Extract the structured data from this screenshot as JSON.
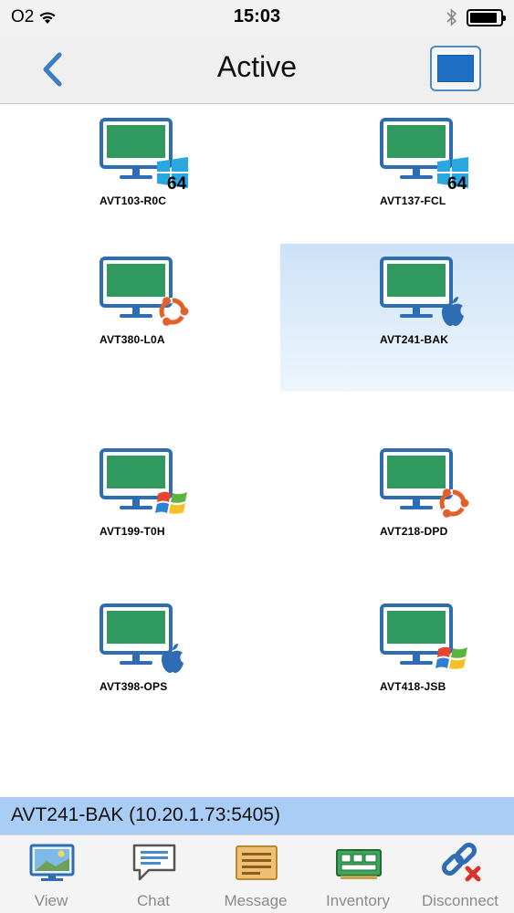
{
  "status_bar": {
    "carrier": "O2",
    "time": "15:03",
    "battery_level": 0.9
  },
  "nav": {
    "title": "Active",
    "back_icon": "chevron-left-icon",
    "toggle_icon": "monitor-view-icon"
  },
  "devices": [
    {
      "name": "AVT103-R0C",
      "os": "windows-10",
      "bits": "64",
      "selected": false
    },
    {
      "name": "AVT137-FCL",
      "os": "windows-10",
      "bits": "64",
      "selected": false
    },
    {
      "name": "AVT380-L0A",
      "os": "ubuntu",
      "bits": "",
      "selected": false
    },
    {
      "name": "AVT241-BAK",
      "os": "apple",
      "bits": "",
      "selected": true
    },
    {
      "name": "AVT199-T0H",
      "os": "windows-xp",
      "bits": "",
      "selected": false
    },
    {
      "name": "AVT218-DPD",
      "os": "ubuntu",
      "bits": "",
      "selected": false
    },
    {
      "name": "AVT398-OPS",
      "os": "apple",
      "bits": "",
      "selected": false
    },
    {
      "name": "AVT418-JSB",
      "os": "windows-xp",
      "bits": "",
      "selected": false
    }
  ],
  "info_bar": {
    "text": "AVT241-BAK (10.20.1.73:5405)"
  },
  "tabs": [
    {
      "label": "View",
      "icon": "view-icon"
    },
    {
      "label": "Chat",
      "icon": "chat-icon"
    },
    {
      "label": "Message",
      "icon": "message-icon"
    },
    {
      "label": "Inventory",
      "icon": "inventory-icon"
    },
    {
      "label": "Disconnect",
      "icon": "disconnect-icon"
    }
  ],
  "colors": {
    "accent": "#2e6db3",
    "screen_green": "#2f9960",
    "selection": "#cde2f7",
    "info_bar": "#a9cdf5"
  }
}
